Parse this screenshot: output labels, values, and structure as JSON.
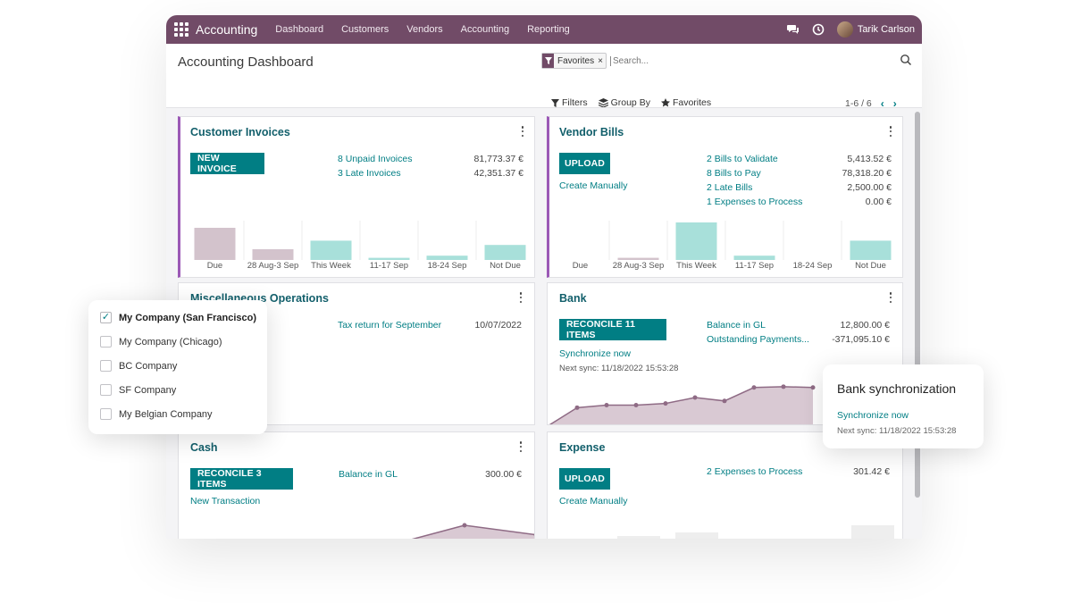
{
  "navbar": {
    "brand": "Accounting",
    "menu": [
      "Dashboard",
      "Customers",
      "Vendors",
      "Accounting",
      "Reporting"
    ],
    "user_name": "Tarik Carlson",
    "bg_color": "#714b67",
    "icons": [
      "apps-grid-icon",
      "chat-icon",
      "clock-icon"
    ]
  },
  "control_panel": {
    "title": "Accounting Dashboard",
    "facet_label": "Favorites",
    "facet_remove": "×",
    "facet_icon": "filter-icon",
    "search_placeholder": "Search...",
    "filters_label": "Filters",
    "group_by_label": "Group By",
    "favorites_label": "Favorites",
    "pager": "1-6 / 6",
    "pager_prev": "‹",
    "pager_next": "›"
  },
  "cards": {
    "customer_invoices": {
      "title": "Customer Invoices",
      "button": "NEW INVOICE",
      "lines": [
        {
          "label": "8 Unpaid Invoices",
          "amount": "81,773.37 €"
        },
        {
          "label": "3 Late Invoices",
          "amount": "42,351.37 €"
        }
      ],
      "bar_labels": [
        "Due",
        "28 Aug-3 Sep",
        "This Week",
        "11-17 Sep",
        "18-24 Sep",
        "Not Due"
      ],
      "bar_values": [
        30,
        10,
        18,
        2,
        4,
        14
      ]
    },
    "vendor_bills": {
      "title": "Vendor Bills",
      "button": "UPLOAD",
      "secondary_link": "Create Manually",
      "lines": [
        {
          "label": "2 Bills to Validate",
          "amount": "5,413.52 €"
        },
        {
          "label": "8 Bills to Pay",
          "amount": "78,318.20 €"
        },
        {
          "label": "2 Late Bills",
          "amount": "2,500.00 €"
        },
        {
          "label": "1 Expenses to Process",
          "amount": "0.00 €"
        }
      ],
      "bar_labels": [
        "Due",
        "28 Aug-3 Sep",
        "This Week",
        "11-17 Sep",
        "18-24 Sep",
        "Not Due"
      ],
      "bar_values": [
        0,
        2,
        35,
        4,
        0,
        18
      ]
    },
    "misc_operations": {
      "title": "Miscellaneous Operations",
      "link": "Tax return for September",
      "date": "10/07/2022"
    },
    "bank": {
      "title": "Bank",
      "button": "RECONCILE 11 ITEMS",
      "sync_link": "Synchronize now",
      "next_sync": "Next sync: 11/18/2022 15:53:28",
      "lines": [
        {
          "label": "Balance in GL",
          "amount": "12,800.00 €"
        },
        {
          "label": "Outstanding Payments...",
          "amount": "-371,095.10 €"
        }
      ],
      "line_values": [
        0,
        22,
        25,
        25,
        27,
        34,
        30,
        46,
        47,
        46
      ]
    },
    "cash": {
      "title": "Cash",
      "button": "RECONCILE 3 ITEMS",
      "secondary_link": "New Transaction",
      "lines": [
        {
          "label": "Balance in GL",
          "amount": "300.00 €"
        }
      ],
      "line_values": [
        0,
        0,
        0,
        10,
        30,
        20,
        15
      ]
    },
    "expense": {
      "title": "Expense",
      "button": "UPLOAD",
      "secondary_link": "Create Manually",
      "lines": [
        {
          "label": "2 Expenses to Process",
          "amount": "301.42 €"
        }
      ]
    }
  },
  "company_switcher": {
    "companies": [
      {
        "name": "My Company (San Francisco)",
        "checked": true
      },
      {
        "name": "My Company (Chicago)",
        "checked": false
      },
      {
        "name": "BC Company",
        "checked": false
      },
      {
        "name": "SF Company",
        "checked": false
      },
      {
        "name": "My Belgian Company",
        "checked": false
      }
    ],
    "check_glyph": "✓"
  },
  "sync_popup": {
    "title": "Bank synchronization",
    "link": "Synchronize now",
    "next_sync": "Next sync: 11/18/2022 15:53:28"
  },
  "colors": {
    "primary": "#017e84",
    "brand": "#714b67",
    "title": "#125f6b",
    "bar_past": "#d3c3cc",
    "bar_future": "#a8e0da",
    "line_fill": "#d9c9d3",
    "line_stroke": "#8f6b85"
  }
}
